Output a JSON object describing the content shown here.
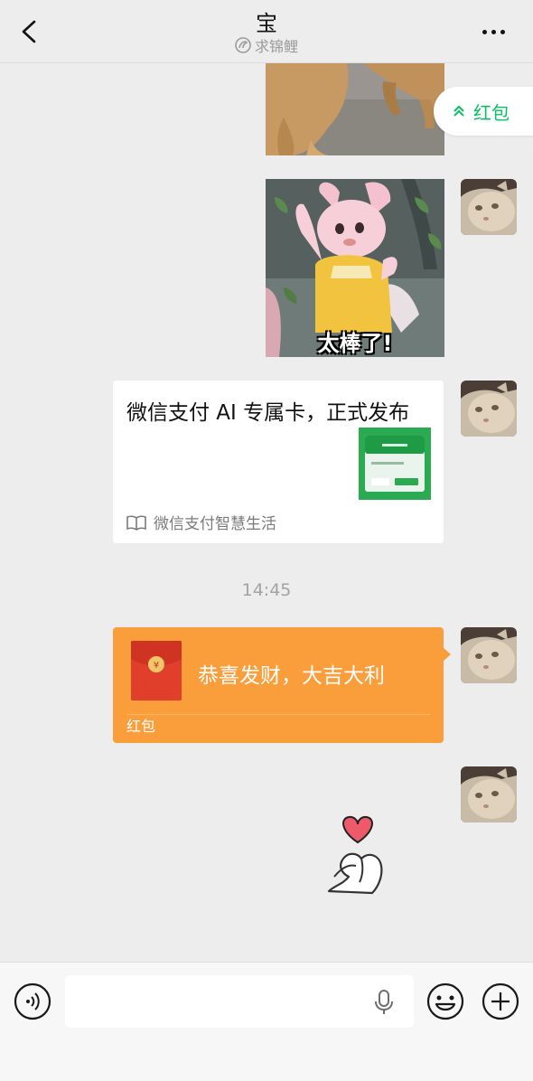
{
  "header": {
    "title": "宝",
    "subtitle": "求锦鲤"
  },
  "floating_red_packet": {
    "label": "红包"
  },
  "sticker_bow": {
    "caption": "太棒了!"
  },
  "article_card": {
    "title": "微信支付 AI 专属卡，正式发布",
    "source": "微信支付智慧生活"
  },
  "timestamp": "14:45",
  "red_envelope": {
    "greeting": "恭喜发财，大吉大利",
    "label": "红包"
  },
  "input_bar": {
    "text": ""
  },
  "colors": {
    "background": "#ededed",
    "wechat_green": "#07c160",
    "red_envelope": "#fa9d3b"
  }
}
